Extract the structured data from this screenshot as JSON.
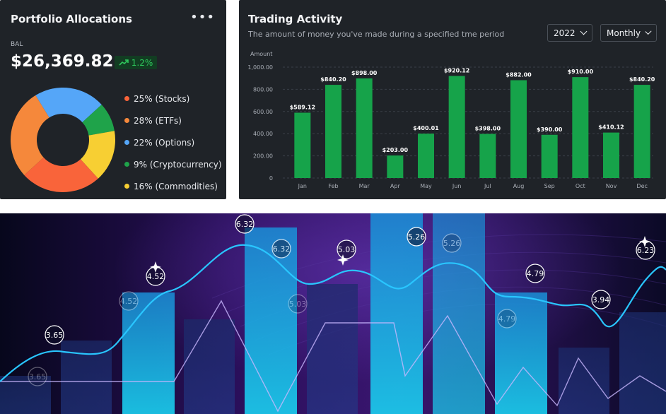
{
  "portfolio": {
    "title": "Portfolio Allocations",
    "menu_icon": "more-horizontal-icon",
    "balance_label": "BAL",
    "balance_value": "$26,369.82",
    "change_icon": "trending-up-icon",
    "change_value": "1.2%",
    "allocations": [
      {
        "label": "25% (Stocks)",
        "percent": 25,
        "color": "#f9643a",
        "icon": "stocks-legend-dot"
      },
      {
        "label": "28% (ETFs)",
        "percent": 28,
        "color": "#f5883b",
        "icon": "etfs-legend-dot"
      },
      {
        "label": "22% (Options)",
        "percent": 22,
        "color": "#55a6f8",
        "icon": "options-legend-dot"
      },
      {
        "label": "9% (Cryptocurrency)",
        "percent": 9,
        "color": "#1fa34a",
        "icon": "cryptocurrency-legend-dot"
      },
      {
        "label": "16% (Commodities)",
        "percent": 16,
        "color": "#f7cf33",
        "icon": "commodities-legend-dot"
      }
    ]
  },
  "trading": {
    "title": "Trading Activity",
    "subtitle": "The amount of money you've made during a specified tme period",
    "year_select": "2022",
    "period_select": "Monthly",
    "chart_data": {
      "type": "bar",
      "ylabel": "Amount",
      "ylim": [
        0,
        1000
      ],
      "yticks": [
        "0",
        "200.00",
        "400.00",
        "600.00",
        "800.00",
        "1,000.00"
      ],
      "ytick_values": [
        0,
        200,
        400,
        600,
        800,
        1000
      ],
      "categories": [
        "Jan",
        "Feb",
        "Mar",
        "Apr",
        "May",
        "Jun",
        "Jul",
        "Aug",
        "Sep",
        "Oct",
        "Nov",
        "Dec"
      ],
      "values": [
        589.12,
        840.2,
        898.0,
        203.0,
        400.01,
        920.12,
        398.0,
        882.0,
        390.0,
        910.0,
        410.12,
        840.2
      ],
      "data_labels": [
        "$589.12",
        "$840.20",
        "$898.00",
        "$203.00",
        "$400.01",
        "$920.12",
        "$398.00",
        "$882.00",
        "$390.00",
        "$910.00",
        "$410.12",
        "$840.20"
      ],
      "bar_color": "#16a34a",
      "grid": true
    }
  },
  "hero": {
    "colors": {
      "line": "#29c6ff",
      "purple": "#4a2a8a",
      "background": "#0a0a2a"
    },
    "labels": [
      "3.65",
      "4.52",
      "6.32",
      "6.32",
      "5.03",
      "5.26",
      "5.26",
      "4.79",
      "3.94",
      "6.23",
      "4.52",
      "5.03",
      "4.79",
      "3.65"
    ]
  }
}
